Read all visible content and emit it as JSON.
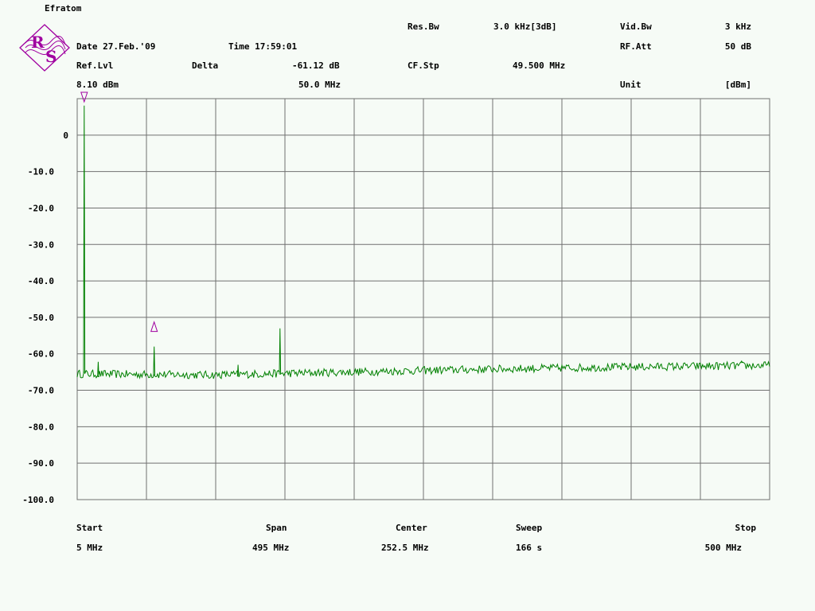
{
  "header": {
    "title": "Efratom",
    "date": "Date 27.Feb.'09",
    "time": "Time 17:59:01",
    "res_bw_label": "Res.Bw",
    "res_bw_value": "3.0 kHz[3dB]",
    "vid_bw_label": "Vid.Bw",
    "vid_bw_value": "3 kHz",
    "rf_att_label": "RF.Att",
    "rf_att_value": "50 dB",
    "ref_lvl_label": "Ref.Lvl",
    "ref_lvl_value": "8.10 dBm",
    "delta_label": "Delta",
    "delta_value": "-61.12 dB",
    "delta_freq": "50.0 MHz",
    "cf_stp_label": "CF.Stp",
    "cf_stp_value": "49.500 MHz",
    "unit_label": "Unit",
    "unit_value": "[dBm]"
  },
  "footer": {
    "start_label": "Start",
    "start_value": "5 MHz",
    "span_label": "Span",
    "span_value": "495 MHz",
    "center_label": "Center",
    "center_value": "252.5 MHz",
    "sweep_label": "Sweep",
    "sweep_value": "166 s",
    "stop_label": "Stop",
    "stop_value": "500 MHz"
  },
  "logo": {
    "letters": [
      "R",
      "S"
    ]
  },
  "colors": {
    "trace": "#008000",
    "grid": "#707070",
    "marker": "#a000a0",
    "background": "#f6fbf6"
  },
  "chart_data": {
    "type": "line",
    "x_unit": "MHz",
    "y_unit": "dBm",
    "xlim": [
      5,
      500
    ],
    "ylim": [
      -100,
      10
    ],
    "y_ticks": [
      0,
      -10,
      -20,
      -30,
      -40,
      -50,
      -60,
      -70,
      -80,
      -90,
      -100
    ],
    "y_tick_labels": [
      "0",
      "-10.0",
      "-20.0",
      "-30.0",
      "-40.0",
      "-50.0",
      "-60.0",
      "-70.0",
      "-80.0",
      "-90.0",
      "-100.0"
    ],
    "x_divisions": 10,
    "grid": true,
    "noise_floor": [
      [
        5,
        -65.5
      ],
      [
        100,
        -65.8
      ],
      [
        200,
        -65.0
      ],
      [
        300,
        -64.2
      ],
      [
        400,
        -63.6
      ],
      [
        500,
        -63.2
      ]
    ],
    "peaks": [
      {
        "x": 10.0,
        "y": 8.1
      },
      {
        "x": 20.0,
        "y": -62.2
      },
      {
        "x": 60.0,
        "y": -58.0
      },
      {
        "x": 120.0,
        "y": -63.0
      },
      {
        "x": 150.0,
        "y": -53.0
      },
      {
        "x": 480.0,
        "y": -62.0
      }
    ],
    "markers": [
      {
        "type": "reference",
        "x": 10.0,
        "y": 8.1
      },
      {
        "type": "delta",
        "x": 60.0,
        "y": -53.0
      }
    ]
  }
}
